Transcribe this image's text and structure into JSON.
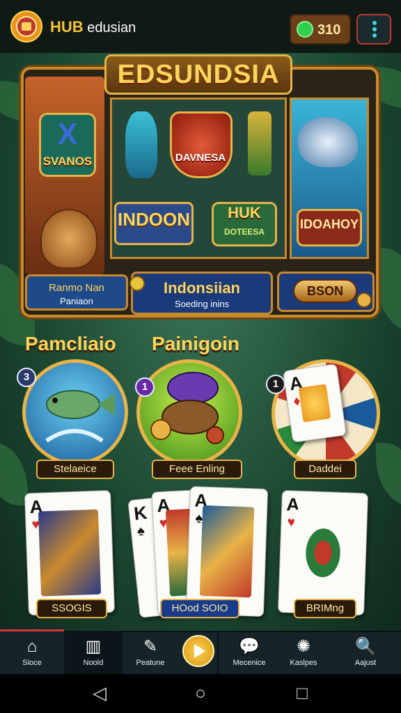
{
  "header": {
    "app_name_bold": "HUB",
    "app_name_rest": "edusian",
    "coin_value": "310",
    "colors": {
      "accent": "#f6c23a",
      "coin_pill": "#6b3f18",
      "menu_border": "#c0392b"
    }
  },
  "banner": {
    "title": "EDSUNDSIA",
    "left_badge": "SVANOS",
    "left_badge_glyph": "X",
    "center_badge": "DAVNESA",
    "tile_indoon": "INDOON",
    "tile_hub_title": "HUK",
    "tile_hub_sub": "DOTEESA",
    "tile_right": "IDOAHOY",
    "btn_left_line1": "Ranmo Nan",
    "btn_left_line2": "Paniaon",
    "btn_mid_line1": "Indonsiian",
    "btn_mid_line2": "Soeding inins",
    "btn_right": "BSON"
  },
  "sections": {
    "left_heading": "Pamcliaio",
    "right_heading": "Painigoin"
  },
  "round_games": [
    {
      "badge": "3",
      "label": "Stelaeice",
      "icon": "fish-icon"
    },
    {
      "badge": "1",
      "label": "Feee Enling",
      "icon": "hat-icon"
    },
    {
      "badge": "1",
      "label": "Daddei",
      "icon": "roulette-icon"
    }
  ],
  "card_games": [
    {
      "label": "SSOGIS",
      "rank": "A",
      "suit": "♥"
    },
    {
      "label": "HOod SOIO",
      "rank": "K",
      "suit": "♠"
    },
    {
      "label": "BRIMng",
      "rank": "A",
      "suit": "♥"
    }
  ],
  "nav": [
    {
      "label": "Sioce",
      "icon": "home-icon",
      "glyph": "⌂"
    },
    {
      "label": "Noold",
      "icon": "inbox-icon",
      "glyph": "▥"
    },
    {
      "label": "Peatune",
      "icon": "pen-icon",
      "glyph": "✎"
    },
    {
      "label": "Mecenice",
      "icon": "chat-icon",
      "glyph": "💬"
    },
    {
      "label": "Kaslpes",
      "icon": "settings-icon",
      "glyph": "✺"
    },
    {
      "label": "Aajust",
      "icon": "search-icon",
      "glyph": "🔍"
    }
  ],
  "system_nav": {
    "back": "◁",
    "home": "○",
    "recents": "□"
  }
}
